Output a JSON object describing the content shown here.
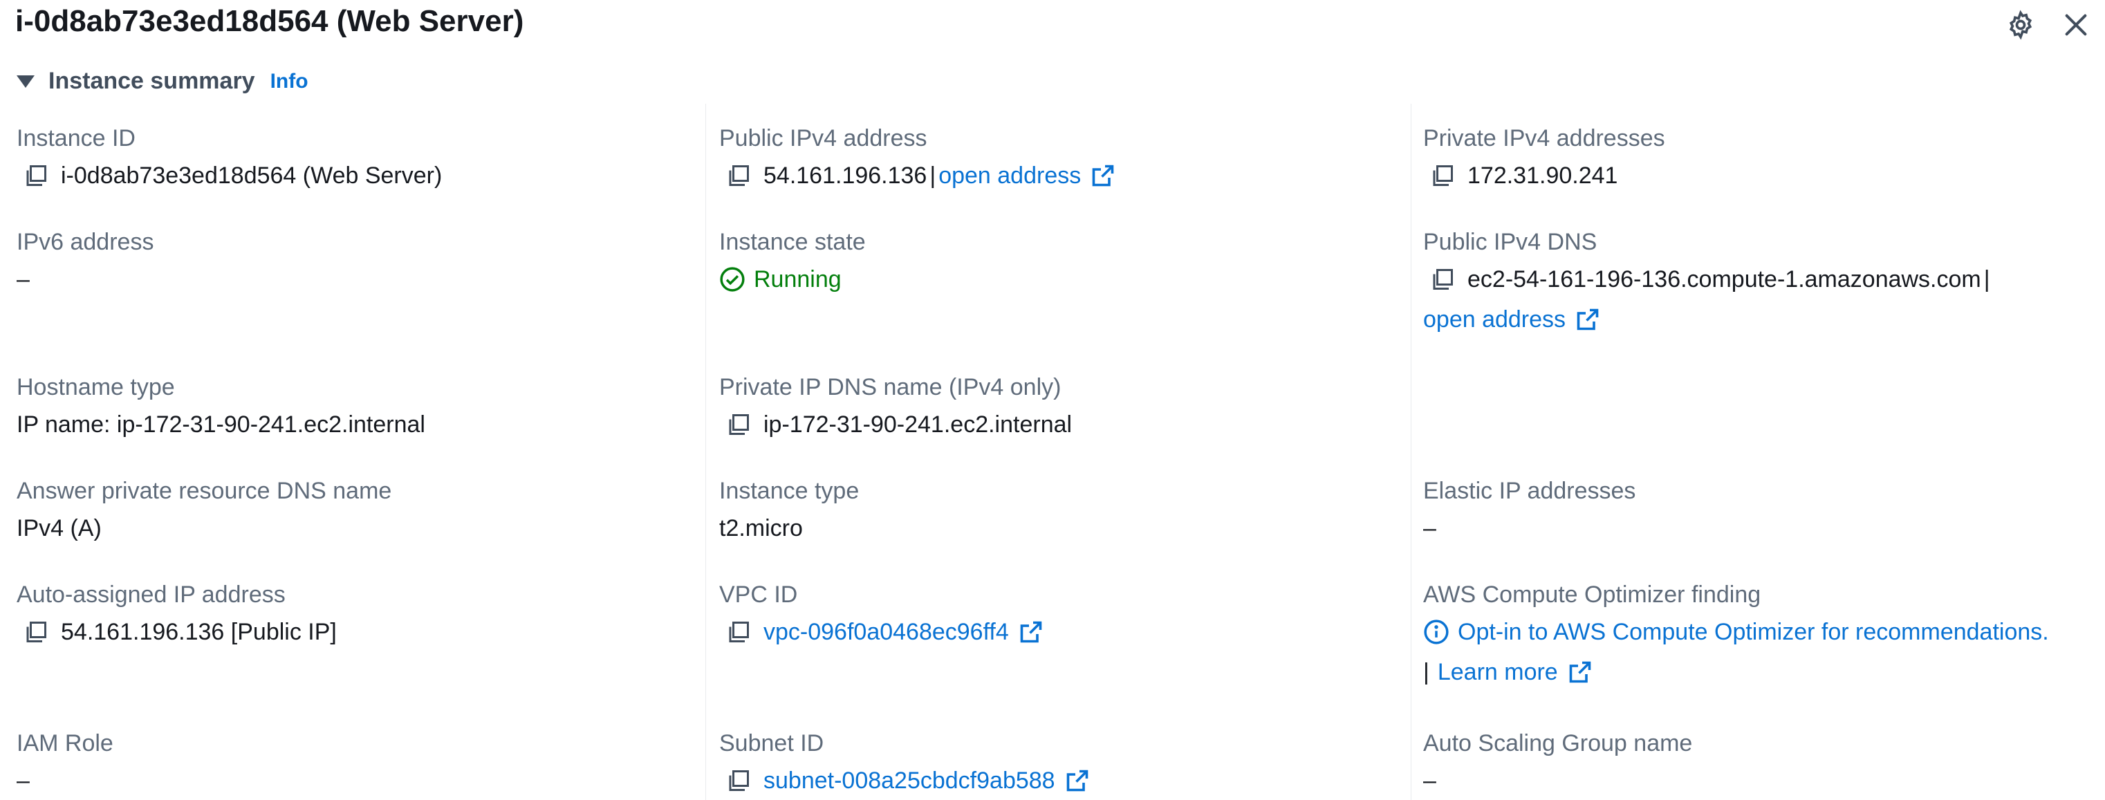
{
  "header": {
    "title": "i-0d8ab73e3ed18d564 (Web Server)",
    "settings_icon": "gear-icon",
    "close_icon": "close-icon"
  },
  "section": {
    "title": "Instance summary",
    "info": "Info"
  },
  "colors": {
    "link": "#0972d3",
    "success": "#037f0c",
    "label": "#5f6b7a",
    "text": "#16191f"
  },
  "col1": {
    "instance_id": {
      "label": "Instance ID",
      "value": "i-0d8ab73e3ed18d564 (Web Server)"
    },
    "ipv6": {
      "label": "IPv6 address",
      "value": "–"
    },
    "hostname_type": {
      "label": "Hostname type",
      "value": "IP name: ip-172-31-90-241.ec2.internal"
    },
    "answer_dns": {
      "label": "Answer private resource DNS name",
      "value": "IPv4 (A)"
    },
    "auto_ip": {
      "label": "Auto-assigned IP address",
      "value": "54.161.196.136 [Public IP]"
    },
    "iam_role": {
      "label": "IAM Role",
      "value": "–"
    }
  },
  "col2": {
    "public_ipv4": {
      "label": "Public IPv4 address",
      "value": "54.161.196.136",
      "sep": "|",
      "link": "open address"
    },
    "state": {
      "label": "Instance state",
      "value": "Running"
    },
    "private_dns": {
      "label": "Private IP DNS name (IPv4 only)",
      "value": "ip-172-31-90-241.ec2.internal"
    },
    "instance_type": {
      "label": "Instance type",
      "value": "t2.micro"
    },
    "vpc": {
      "label": "VPC ID",
      "value": "vpc-096f0a0468ec96ff4"
    },
    "subnet": {
      "label": "Subnet ID",
      "value": "subnet-008a25cbdcf9ab588"
    }
  },
  "col3": {
    "private_ipv4": {
      "label": "Private IPv4 addresses",
      "value": "172.31.90.241"
    },
    "public_dns": {
      "label": "Public IPv4 DNS",
      "value": "ec2-54-161-196-136.compute-1.amazonaws.com",
      "sep": "|",
      "link": "open address"
    },
    "elastic_ip": {
      "label": "Elastic IP addresses",
      "value": "–"
    },
    "optimizer": {
      "label": "AWS Compute Optimizer finding",
      "link": "Opt-in to AWS Compute Optimizer for recommendations.",
      "sep": "|",
      "learn_more": "Learn more"
    },
    "asg": {
      "label": "Auto Scaling Group name",
      "value": "–"
    }
  }
}
